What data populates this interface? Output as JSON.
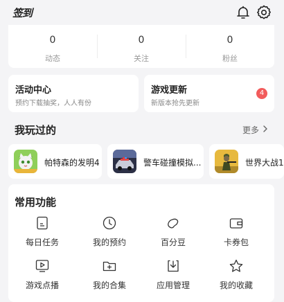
{
  "header": {
    "signin_label": "签到",
    "bell_icon": "bell-icon",
    "settings_icon": "gear-icon"
  },
  "stats": [
    {
      "value": "0",
      "label": "动态"
    },
    {
      "value": "0",
      "label": "关注"
    },
    {
      "value": "0",
      "label": "粉丝"
    }
  ],
  "activity": {
    "title": "活动中心",
    "subtitle": "预约下载抽奖，人人有份"
  },
  "updates": {
    "title": "游戏更新",
    "subtitle": "新版本抢先更新",
    "badge": "4"
  },
  "played": {
    "title": "我玩过的",
    "more": "更多",
    "games": [
      {
        "name": "帕特森的发明4"
      },
      {
        "name": "警车碰撞模拟..."
      },
      {
        "name": "世界大战1"
      }
    ]
  },
  "features": {
    "title": "常用功能",
    "items": [
      {
        "label": "每日任务",
        "icon": "daily-task-icon"
      },
      {
        "label": "我的预约",
        "icon": "clock-icon"
      },
      {
        "label": "百分豆",
        "icon": "bean-icon"
      },
      {
        "label": "卡券包",
        "icon": "wallet-icon"
      },
      {
        "label": "游戏点播",
        "icon": "play-icon"
      },
      {
        "label": "我的合集",
        "icon": "folder-add-icon"
      },
      {
        "label": "应用管理",
        "icon": "download-icon"
      },
      {
        "label": "我的收藏",
        "icon": "star-icon"
      }
    ]
  },
  "colors": {
    "accent": "#f25b5b",
    "background": "#f4f4f6",
    "card": "#ffffff"
  }
}
